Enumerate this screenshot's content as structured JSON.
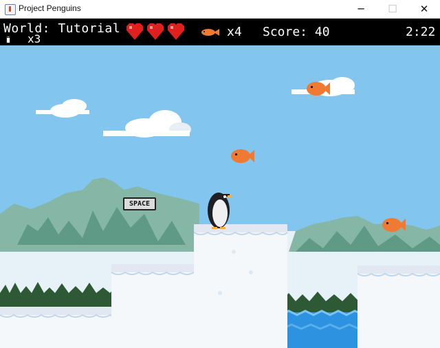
{
  "window": {
    "title": "Project Penguins",
    "controls": {
      "minimize": "─",
      "maximize": "☐",
      "close": "✕"
    }
  },
  "hud": {
    "world_label": "World: Tutorial",
    "lives_text": "x3",
    "lives": 3,
    "hearts": 3,
    "fish_text": "x4",
    "fish_collected": 4,
    "score_text": "Score: 40",
    "time_text": "2:22"
  },
  "scene": {
    "hint_key_label": "SPACE",
    "colors": {
      "sky": "#82c6ef",
      "mountain": "#86b7a6",
      "mountain_dark": "#5f9a86",
      "snow": "#f4f8fb",
      "water": "#2d93e1",
      "heart": "#e01f1f",
      "fish": "#f07a32"
    },
    "icons": [
      "penguin",
      "fish",
      "cloud",
      "heart",
      "space-key"
    ]
  }
}
